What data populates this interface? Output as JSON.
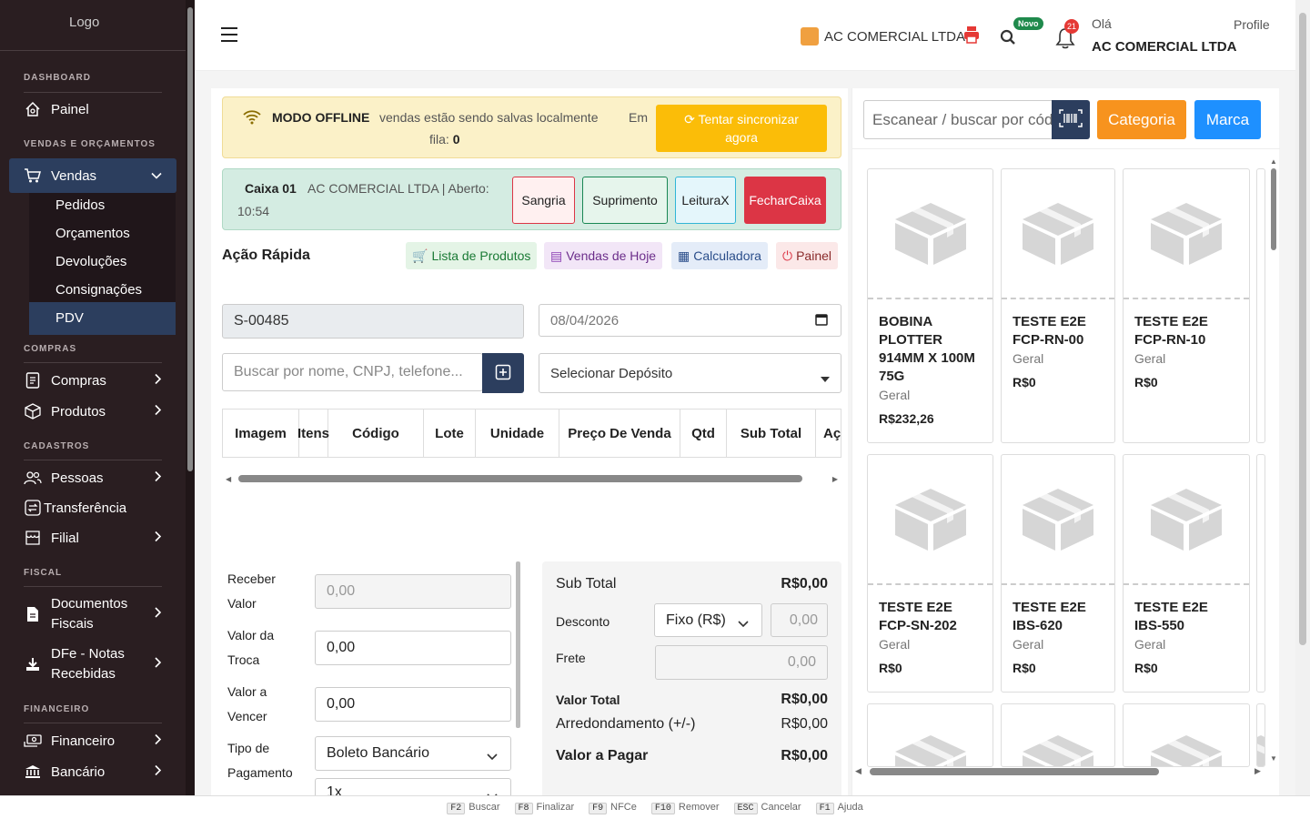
{
  "sidebar": {
    "logo_alt": "Logo",
    "sections": [
      "DASHBOARD",
      "VENDAS E ORÇAMENTOS",
      "COMPRAS",
      "CADASTROS",
      "FISCAL",
      "FINANCEIRO"
    ],
    "painel": "Painel",
    "vendas": "Vendas",
    "vendas_sub": [
      "Pedidos",
      "Orçamentos",
      "Devoluções",
      "Consignações",
      "PDV"
    ],
    "compras": "Compras",
    "produtos": "Produtos",
    "pessoas": "Pessoas",
    "transferencia": "Transferência",
    "filial": "Filial",
    "documentos_l1": "Documentos",
    "documentos_l2": "Fiscais",
    "dfe_l1": "DFe - Notas",
    "dfe_l2": "Recebidas",
    "financeiro": "Financeiro",
    "bancario": "Bancário"
  },
  "topbar": {
    "company": "AC COMERCIAL LTDA",
    "novo_badge": "Novo",
    "notif_count": "21",
    "greeting": "Olá",
    "user_name": "AC COMERCIAL LTDA",
    "profile_alt": "Profile"
  },
  "offline": {
    "title": "MODO OFFLINE",
    "message": "vendas estão sendo salvas localmente",
    "queue_prefix": "Em",
    "queue_label": "fila:",
    "queue_count": "0",
    "sync_l1": "Tentar sincronizar",
    "sync_l2": "agora"
  },
  "caixa": {
    "name": "Caixa 01",
    "info": "AC COMERCIAL LTDA | Aberto:",
    "time": "10:54",
    "sangria": "Sangria",
    "suprimento": "Suprimento",
    "leitura_l1": "Leitura",
    "leitura_l2": "X",
    "fechar_l1": "Fechar",
    "fechar_l2": "Caixa"
  },
  "acao": {
    "title": "Ação Rápida",
    "lista": "Lista de Produtos",
    "vendas_hoje": "Vendas de Hoje",
    "calculadora": "Calculadora",
    "painel": "Painel"
  },
  "form": {
    "sale_code": "S-00485",
    "date": "08/04/2026",
    "customer_placeholder": "Buscar por nome, CNPJ, telefone...",
    "deposit": "Selecionar Depósito"
  },
  "table": {
    "columns": [
      "Imagem",
      "Itens",
      "Código",
      "Lote",
      "Unidade",
      "Preço De Venda",
      "Qtd",
      "Sub Total",
      "Ações"
    ]
  },
  "payment": {
    "receber_l1": "Receber",
    "receber_l2": "Valor",
    "receber_placeholder": "0,00",
    "troca_l1": "Valor da",
    "troca_l2": "Troca",
    "troca_value": "0,00",
    "vencer_l1": "Valor a",
    "vencer_l2": "Vencer",
    "vencer_value": "0,00",
    "tipo_l1": "Tipo de",
    "tipo_l2": "Pagamento",
    "tipo_value": "Boleto Bancário",
    "parcelas": "1x"
  },
  "totals": {
    "subtotal_label": "Sub Total",
    "subtotal": "R$0,00",
    "desconto_label": "Desconto",
    "desconto_type": "Fixo (R$)",
    "desconto_value": "0,00",
    "frete_label": "Frete",
    "frete_value": "0,00",
    "valor_total_label": "Valor Total",
    "valor_total": "R$0,00",
    "arred_label": "Arredondamento (+/-)",
    "arred": "R$0,00",
    "pagar_label": "Valor a Pagar",
    "pagar": "R$0,00"
  },
  "products_panel": {
    "search_placeholder": "Escanear / buscar por código",
    "categoria": "Categoria",
    "marca": "Marca",
    "products": [
      {
        "name": "BOBINA PLOTTER 914MM X 100M 75G",
        "category": "Geral",
        "price": "R$232,26"
      },
      {
        "name": "TESTE E2E FCP-RN-00",
        "category": "Geral",
        "price": "R$0"
      },
      {
        "name": "TESTE E2E FCP-RN-10",
        "category": "Geral",
        "price": "R$0"
      },
      {
        "name": "TESTE E2E FCP-SN-202",
        "category": "Geral",
        "price": "R$0"
      },
      {
        "name": "TESTE E2E IBS-620",
        "category": "Geral",
        "price": "R$0"
      },
      {
        "name": "TESTE E2E IBS-550",
        "category": "Geral",
        "price": "R$0"
      }
    ]
  },
  "footer": {
    "shortcuts": [
      {
        "key": "F2",
        "label": "Buscar"
      },
      {
        "key": "F8",
        "label": "Finalizar"
      },
      {
        "key": "F9",
        "label": "NFCe"
      },
      {
        "key": "F10",
        "label": "Remover"
      },
      {
        "key": "ESC",
        "label": "Cancelar"
      },
      {
        "key": "F1",
        "label": "Ajuda"
      }
    ]
  }
}
